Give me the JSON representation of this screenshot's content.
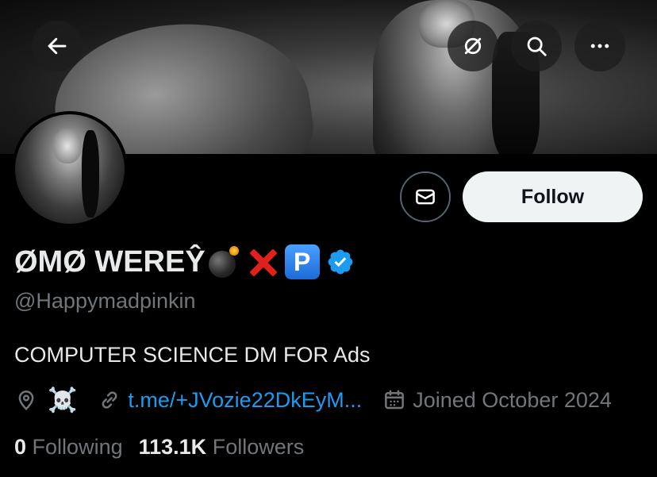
{
  "header": {
    "back_icon": "arrow-left-icon",
    "grok_icon": "slashed-circle-icon",
    "search_icon": "search-icon",
    "more_icon": "ellipsis-icon"
  },
  "actions": {
    "message_icon": "envelope-icon",
    "follow_label": "Follow"
  },
  "profile": {
    "display_name": "ØMØ WEREŶ",
    "name_emojis": [
      "bomb",
      "cross-mark",
      "p-button"
    ],
    "p_button_text": "P",
    "verified_color": "#1d9bf0",
    "handle": "@Happymadpinkin",
    "bio": "COMPUTER SCIENCE DM FOR Ads",
    "location_icon": "location-pin-icon",
    "location": "☠️",
    "link_icon": "link-icon",
    "link_text": "t.me/+JVozie22DkEyM...",
    "calendar_icon": "calendar-icon",
    "joined": "Joined October 2024"
  },
  "stats": {
    "following_count": "0",
    "following_label": "Following",
    "followers_count": "113.1K",
    "followers_label": "Followers"
  },
  "colors": {
    "background": "#000000",
    "link": "#1d9bf0",
    "muted": "#71767b",
    "follow_button_bg": "#eff3f4"
  }
}
